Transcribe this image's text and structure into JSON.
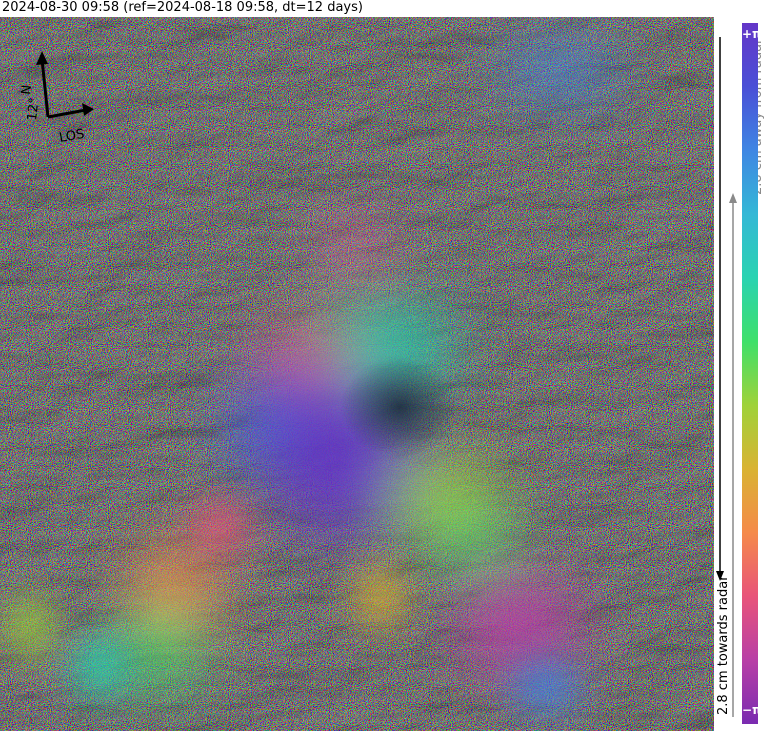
{
  "header": {
    "title": "2024-08-30 09:58 (ref=2024-08-18 09:58, dt=12 days)"
  },
  "compass": {
    "north_label": "N",
    "angle_label": "12°",
    "los_label": "LOS"
  },
  "colorbar": {
    "top_symbol": "+π",
    "bottom_symbol": "−π",
    "away_label": "2.8 cm away from radar",
    "towards_label": "2.8 cm towards radar",
    "colors": [
      "#7a2bb0",
      "#b83fa6",
      "#e8547a",
      "#f58a4a",
      "#d9b332",
      "#9fd23a",
      "#3fe06a",
      "#2ad3b1",
      "#34b8d6",
      "#3f86e3",
      "#4a4fd6",
      "#6436c8"
    ]
  },
  "image": {
    "description_icon": "interferogram-icon"
  }
}
